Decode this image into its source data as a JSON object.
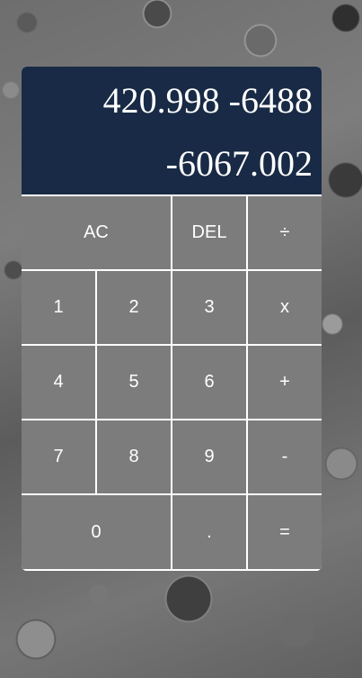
{
  "display": {
    "previous": "420.998 -6488",
    "current": "-6067.002"
  },
  "keys": {
    "clear": "AC",
    "delete": "DEL",
    "divide": "÷",
    "one": "1",
    "two": "2",
    "three": "3",
    "multiply": "x",
    "four": "4",
    "five": "5",
    "six": "6",
    "add": "+",
    "seven": "7",
    "eight": "8",
    "nine": "9",
    "subtract": "-",
    "zero": "0",
    "decimal": ".",
    "equals": "="
  },
  "colors": {
    "display_background": "#182a45",
    "key_background": "#7c7c7c",
    "key_text": "#ffffff",
    "separator": "#ffffff"
  }
}
